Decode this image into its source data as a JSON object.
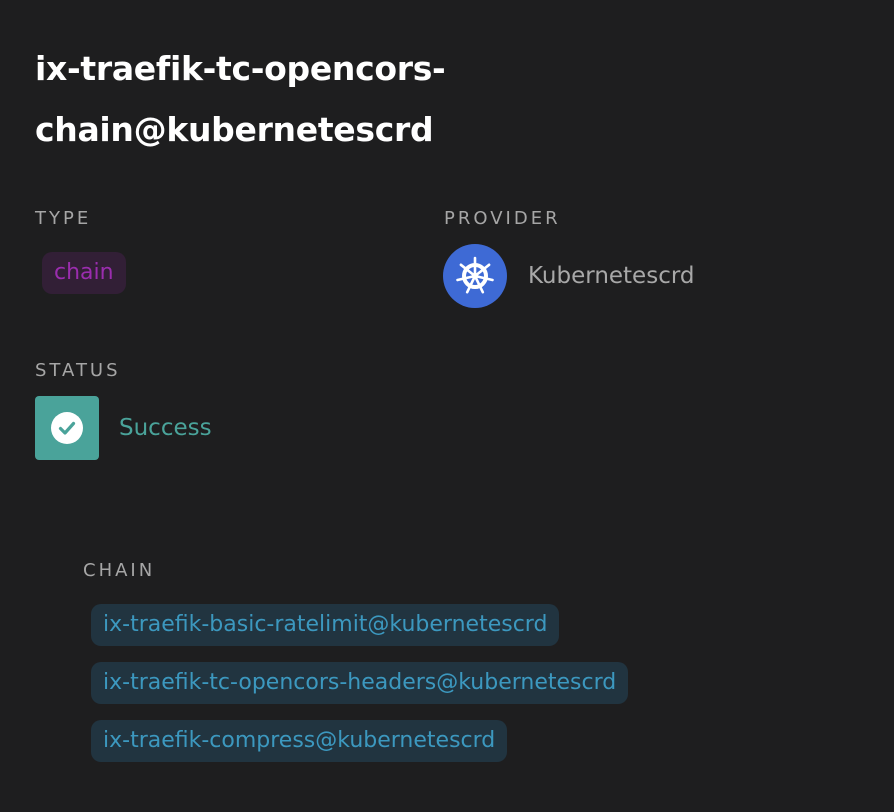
{
  "middleware": {
    "title": "ix-traefik-tc-opencors-chain@kubernetescrd"
  },
  "type": {
    "label": "TYPE",
    "value": "chain"
  },
  "provider": {
    "label": "PROVIDER",
    "name": "Kubernetescrd",
    "icon": "kubernetes-icon"
  },
  "status": {
    "label": "STATUS",
    "value": "Success",
    "icon": "check-icon"
  },
  "chain": {
    "label": "CHAIN",
    "items": [
      "ix-traefik-basic-ratelimit@kubernetescrd",
      "ix-traefik-tc-opencors-headers@kubernetescrd",
      "ix-traefik-compress@kubernetescrd"
    ]
  },
  "colors": {
    "background": "#1e1e1f",
    "type_badge_bg": "#321f36",
    "type_badge_text": "#9a2dae",
    "provider_icon_bg": "#3e6ad5",
    "success": "#4aa39a",
    "chain_badge_bg": "#213440",
    "chain_badge_text": "#3c98bf"
  }
}
